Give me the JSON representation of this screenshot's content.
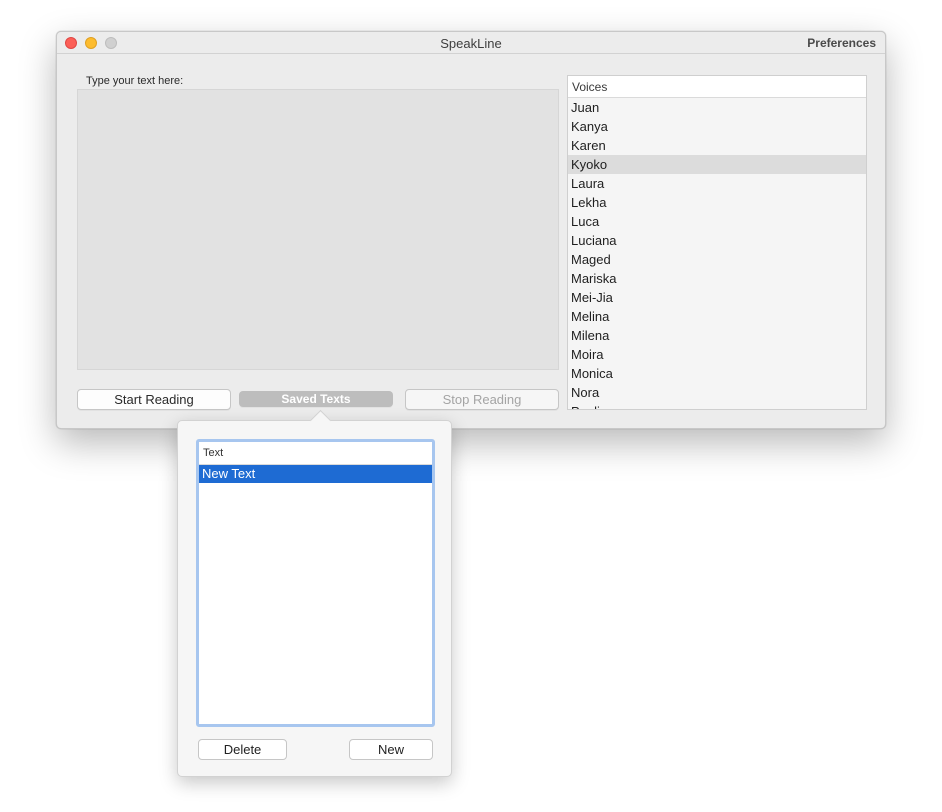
{
  "window": {
    "title": "SpeakLine",
    "preferences_label": "Preferences"
  },
  "editor": {
    "label": "Type your text here:"
  },
  "buttons": {
    "start": "Start Reading",
    "saved": "Saved Texts",
    "stop": "Stop Reading"
  },
  "voices": {
    "header": "Voices",
    "selected": "Kyoko",
    "items": [
      "Juan",
      "Kanya",
      "Karen",
      "Kyoko",
      "Laura",
      "Lekha",
      "Luca",
      "Luciana",
      "Maged",
      "Mariska",
      "Mei-Jia",
      "Melina",
      "Milena",
      "Moira",
      "Monica",
      "Nora",
      "Paulina"
    ]
  },
  "saved_popover": {
    "header": "Text",
    "rows": [
      "New Text"
    ],
    "delete_label": "Delete",
    "new_label": "New"
  },
  "colors": {
    "selection_blue": "#1e6bd3",
    "focus_ring": "#a7c6ef",
    "close": "#fc5f57",
    "minimize": "#fdbc2e"
  }
}
